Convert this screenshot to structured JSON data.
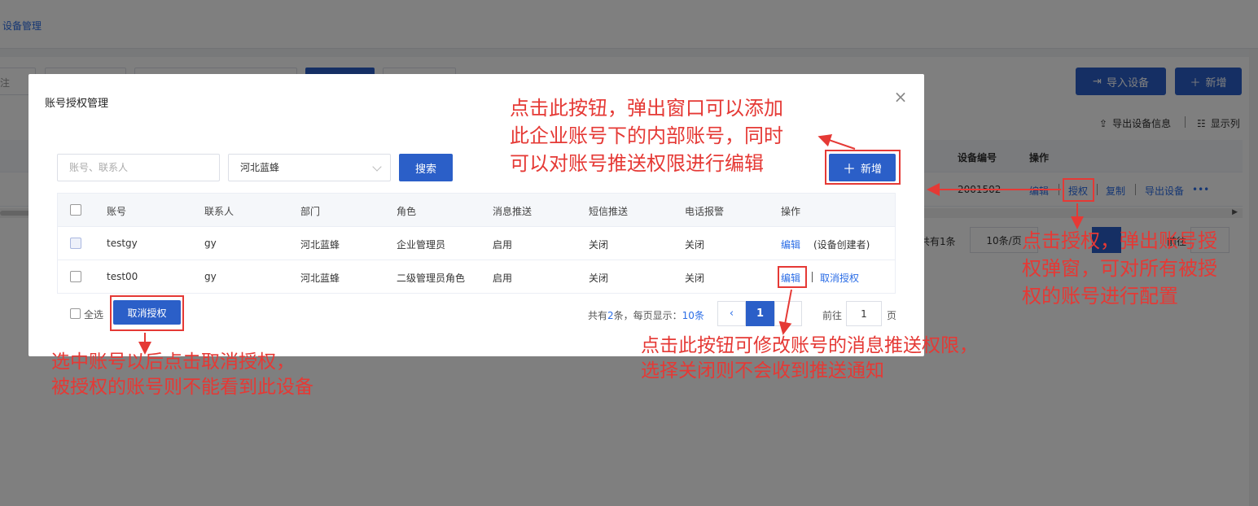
{
  "background": {
    "breadcrumb": "设备管理",
    "filter_placeholder_fragment": "注",
    "buttons": {
      "import": "导入设备",
      "add": "新增"
    },
    "toolbar": {
      "export_info": "导出设备信息",
      "columns": "显示列"
    },
    "table": {
      "headers": {
        "device_no": "设备编号",
        "ops": "操作"
      },
      "row": {
        "device_no": "2001502",
        "ops": [
          "编辑",
          "授权",
          "复制",
          "导出设备"
        ],
        "more": "•••"
      }
    },
    "pager": {
      "total": "共有1条",
      "per_page": "10条/页",
      "prev": "前往"
    }
  },
  "dialog": {
    "title": "账号授权管理",
    "close": "×",
    "search_placeholder": "账号、联系人",
    "select_value": "河北蓝蜂",
    "search_button": "搜索",
    "add_button": "新增",
    "columns": [
      "账号",
      "联系人",
      "部门",
      "角色",
      "消息推送",
      "短信推送",
      "电话报警",
      "操作"
    ],
    "rows": [
      {
        "account": "testgy",
        "contact": "gy",
        "dept": "河北蓝蜂",
        "role": "企业管理员",
        "msg": "启用",
        "sms": "关闭",
        "phone": "关闭",
        "edit": "编辑",
        "extra": "(设备创建者)"
      },
      {
        "account": "test00",
        "contact": "gy",
        "dept": "河北蓝蜂",
        "role": "二级管理员角色",
        "msg": "启用",
        "sms": "关闭",
        "phone": "关闭",
        "edit": "编辑",
        "extra": "取消授权"
      }
    ],
    "select_all": "全选",
    "revoke_button": "取消授权",
    "pager": {
      "total_prefix": "共有",
      "total_count": "2",
      "total_mid": "条，每页显示：",
      "per_page": "10条",
      "prev": "‹",
      "current": "1",
      "goto": "前往",
      "goto_value": "1",
      "page_suffix": "页"
    }
  },
  "annotations": {
    "add": [
      "点击此按钮，弹出窗口可以添加",
      "此企业账号下的内部账号，同时",
      "可以对账号推送权限进行编辑"
    ],
    "auth": [
      "点击授权，弹出账号授",
      "权弹窗，可对所有被授",
      "权的账号进行配置"
    ],
    "edit": [
      "点击此按钮可修改账号的消息推送权限，",
      "选择关闭则不会收到推送通知"
    ],
    "revoke": [
      "选中账号以后点击取消授权，",
      "被授权的账号则不能看到此设备"
    ]
  },
  "colors": {
    "primary": "#2b5fc8",
    "annotation": "#e53935",
    "link": "#2b6de6"
  }
}
